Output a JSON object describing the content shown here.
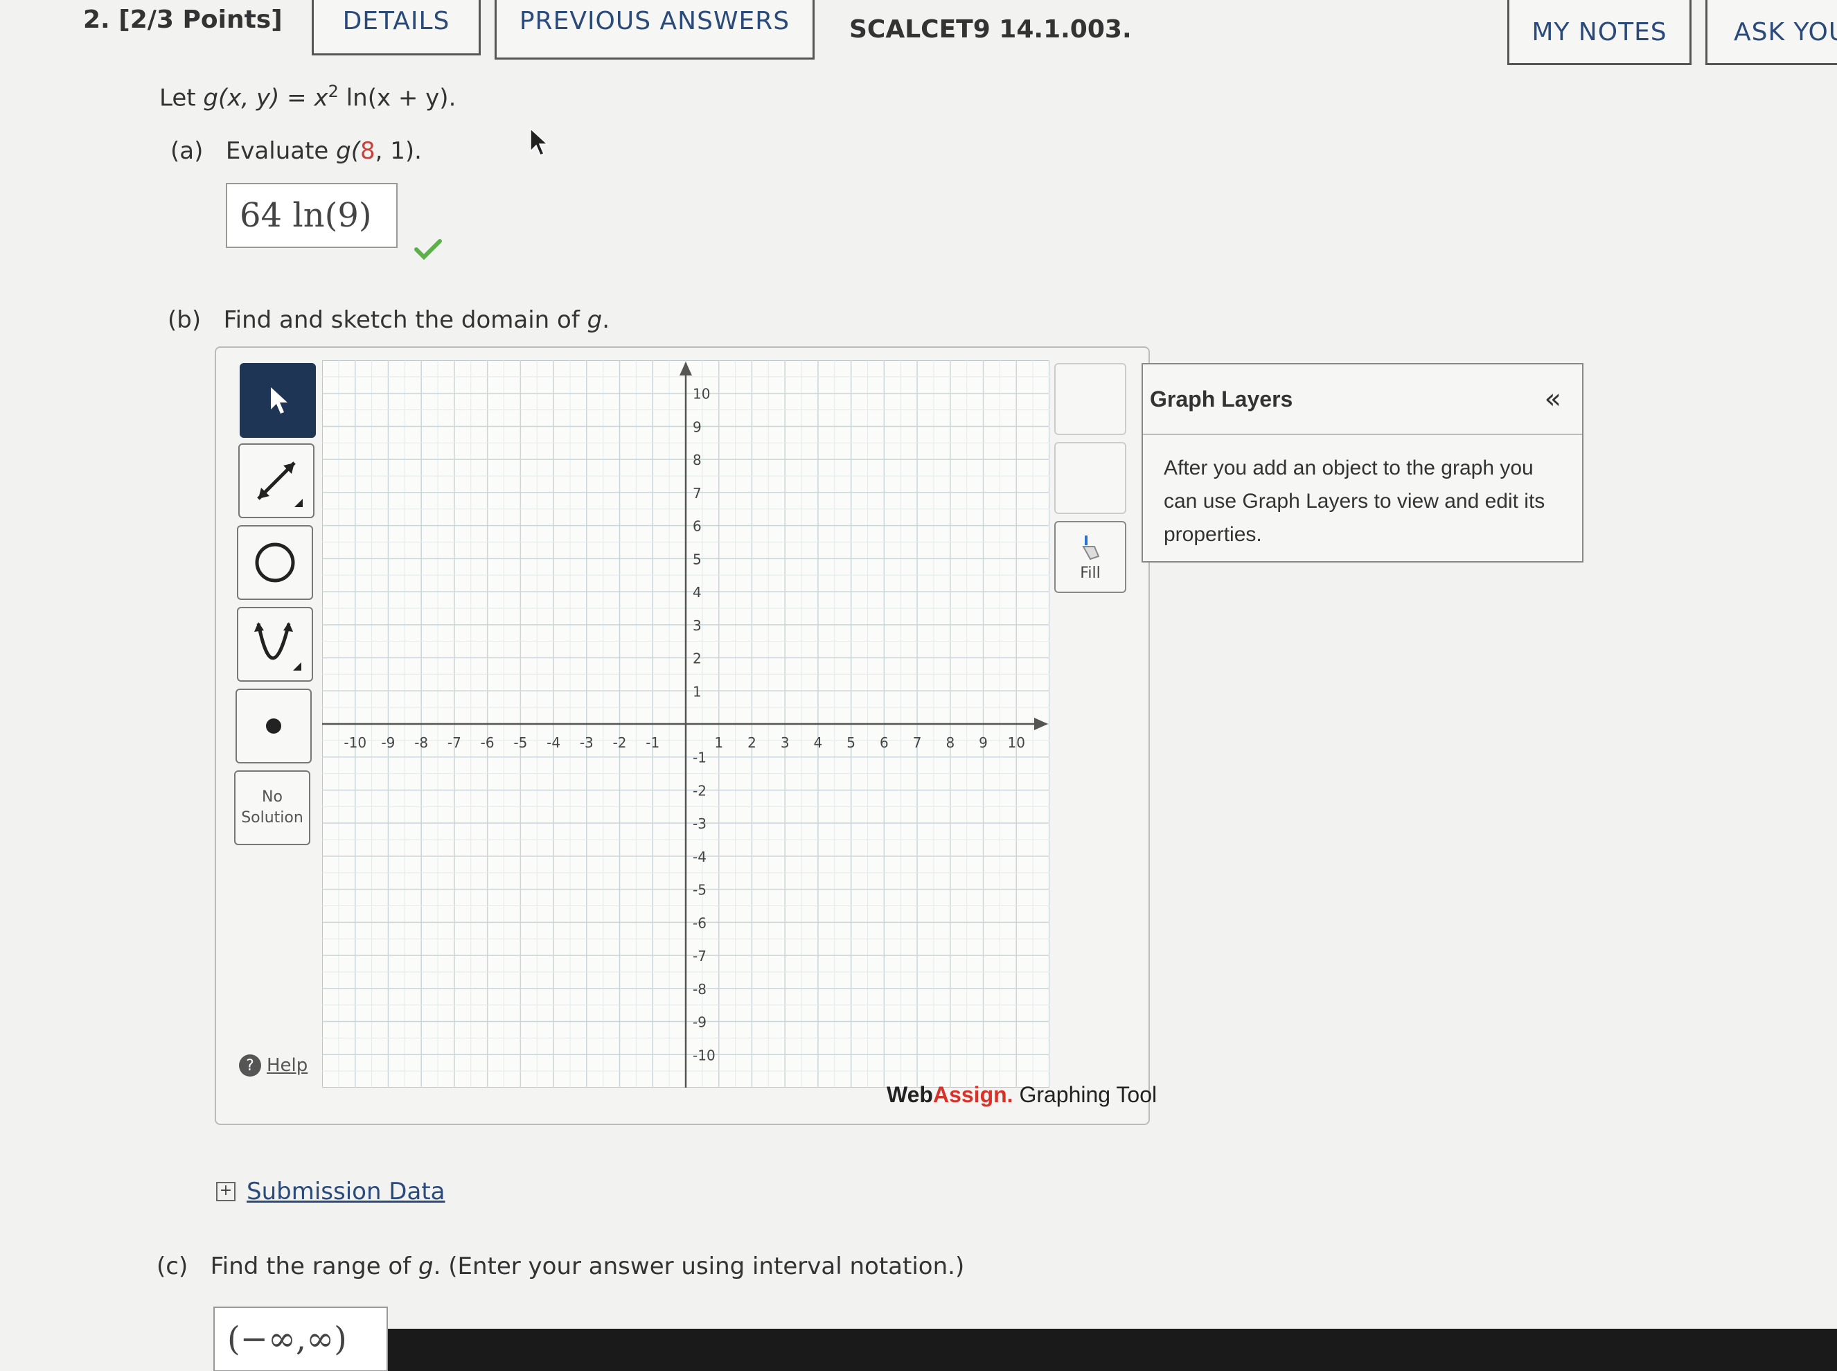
{
  "header": {
    "question_number": "2.",
    "points": "[2/3 Points]",
    "details_button": "DETAILS",
    "previous_answers_button": "PREVIOUS ANSWERS",
    "problem_code": "SCALCET9 14.1.003.",
    "my_notes_button": "MY NOTES",
    "ask_button": "ASK YOU"
  },
  "problem": {
    "intro_prefix": "Let ",
    "intro_func": "g(x, y) = x",
    "intro_exp": "2",
    "intro_suffix": " ln(x + y).",
    "part_a_label": "(a)",
    "part_a_text_prefix": "Evaluate ",
    "part_a_func": "g(",
    "part_a_red": "8",
    "part_a_rest": ", 1).",
    "part_a_answer": "64 ln(9)",
    "part_a_correct": true,
    "part_b_label": "(b)",
    "part_b_text": "Find and sketch the domain of ",
    "part_b_var": "g",
    "part_b_end": ".",
    "part_c_label": "(c)",
    "part_c_text": "Find the range of ",
    "part_c_var": "g",
    "part_c_end": ". (Enter your answer using interval notation.)",
    "part_c_answer": "(−∞,∞)"
  },
  "graph_tool": {
    "tools": [
      {
        "name": "select-tool",
        "icon": "arrow-pointer-icon",
        "active": true
      },
      {
        "name": "line-tool",
        "icon": "line-arrow-icon",
        "active": false
      },
      {
        "name": "circle-tool",
        "icon": "circle-icon",
        "active": false
      },
      {
        "name": "parabola-tool",
        "icon": "parabola-icon",
        "active": false
      },
      {
        "name": "point-tool",
        "icon": "point-icon",
        "active": false
      }
    ],
    "no_solution_line1": "No",
    "no_solution_line2": "Solution",
    "help_label": "Help",
    "fill_label": "Fill",
    "x_ticks": [
      "-10",
      "-9",
      "-8",
      "-7",
      "-6",
      "-5",
      "-4",
      "-3",
      "-2",
      "-1",
      "1",
      "2",
      "3",
      "4",
      "5",
      "6",
      "7",
      "8",
      "9",
      "10"
    ],
    "y_ticks": [
      "10",
      "9",
      "8",
      "7",
      "6",
      "5",
      "4",
      "3",
      "2",
      "1",
      "-1",
      "-2",
      "-3",
      "-4",
      "-5",
      "-6",
      "-7",
      "-8",
      "-9",
      "-10"
    ],
    "axis_range": {
      "xmin": -11,
      "xmax": 11,
      "ymin": -11,
      "ymax": 11
    },
    "brand_web": "Web",
    "brand_assign": "Assign.",
    "brand_tool": " Graphing Tool"
  },
  "graph_layers": {
    "title": "Graph Layers",
    "collapse_glyph": "«",
    "body": "After you add an object to the graph you can use Graph Layers to view and edit its properties."
  },
  "submission": {
    "toggle_glyph": "+",
    "link_label": "Submission Data"
  },
  "colors": {
    "accent_blue": "#2a4a7a",
    "active_tool": "#1f3556",
    "check_green": "#5cb04a",
    "brand_red": "#d6322a"
  }
}
